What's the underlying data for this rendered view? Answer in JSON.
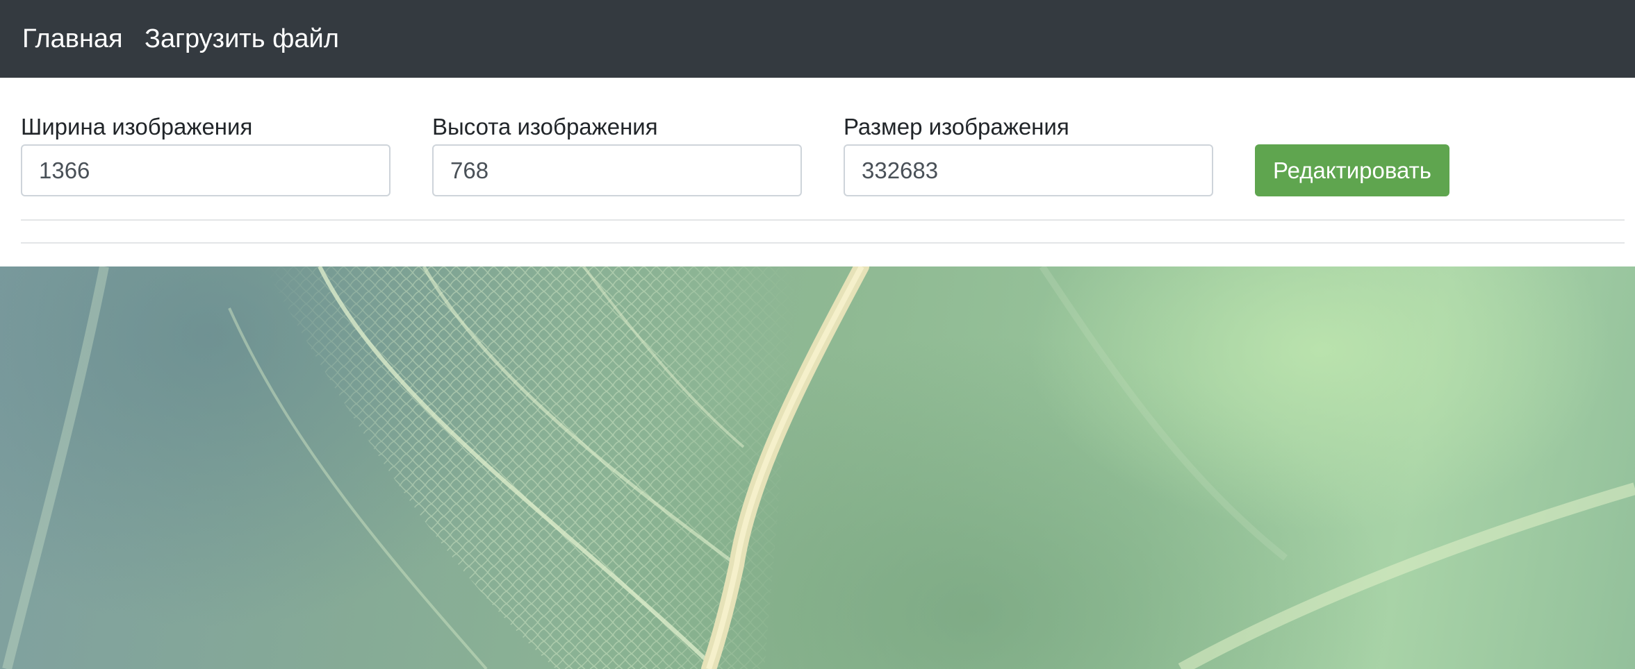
{
  "nav": {
    "home": "Главная",
    "upload": "Загрузить файл"
  },
  "form": {
    "width": {
      "label": "Ширина изображения",
      "value": "1366"
    },
    "height": {
      "label": "Высота изображения",
      "value": "768"
    },
    "size": {
      "label": "Размер изображения",
      "value": "332683"
    },
    "edit_button": "Редактировать"
  },
  "colors": {
    "navbar": "#343a40",
    "button": "#5fa54f",
    "input_border": "#ced4da"
  },
  "hero": {
    "image": "leaf-macro-background"
  }
}
